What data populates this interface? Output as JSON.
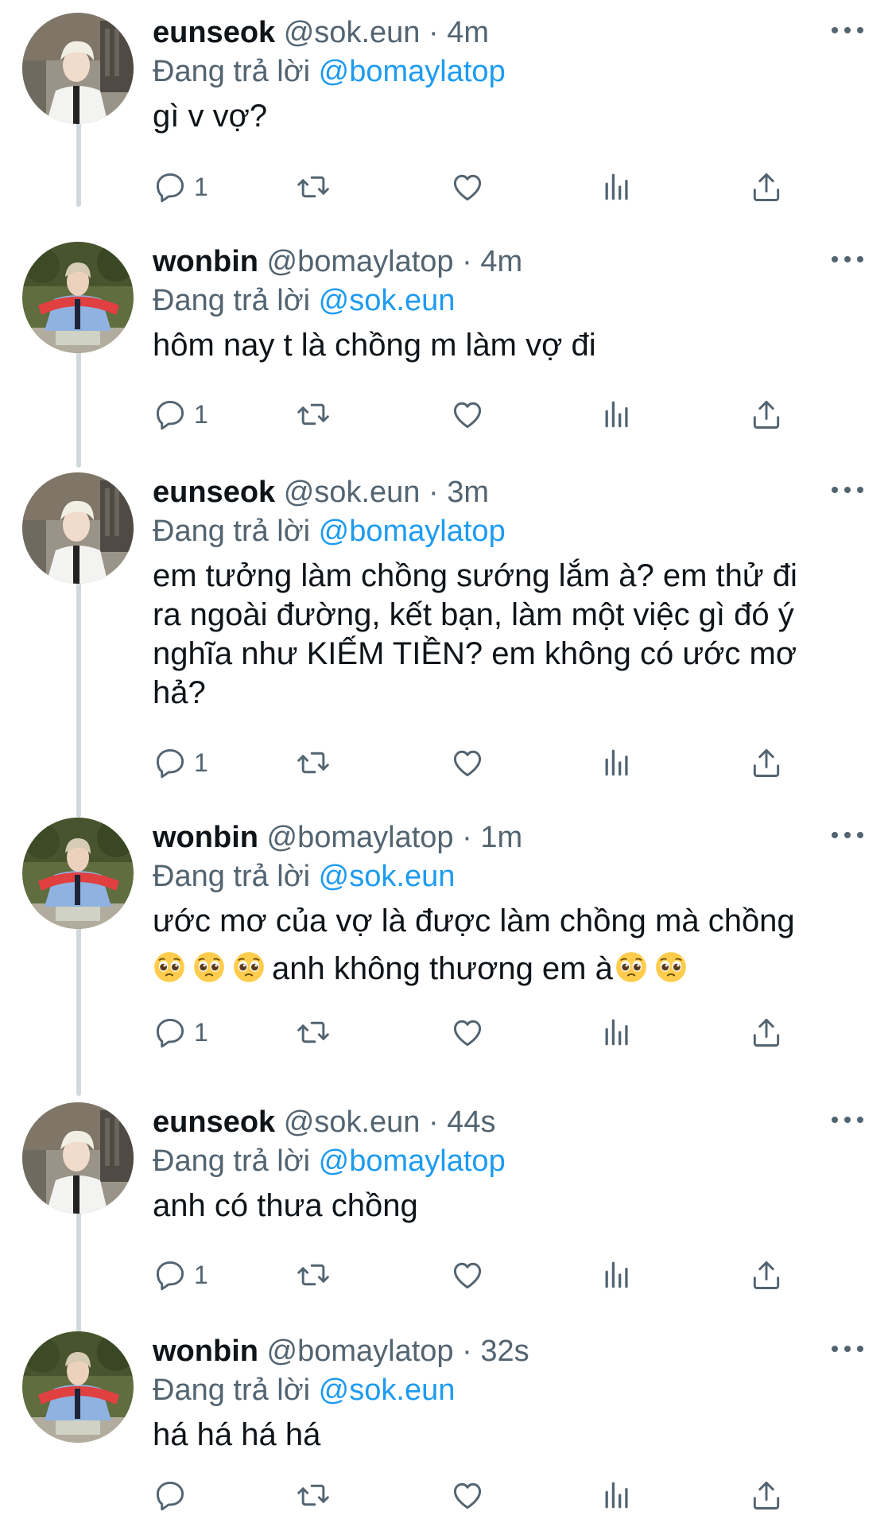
{
  "reply_prefix": "Đang trả lời",
  "tweets": [
    {
      "name": "eunseok",
      "handle": "@sok.eun",
      "separator": "·",
      "time": "4m",
      "replying_to": "@bomaylatop",
      "text": "gì v vợ?",
      "reply_count": "1"
    },
    {
      "name": "wonbin",
      "handle": "@bomaylatop",
      "separator": "·",
      "time": "4m",
      "replying_to": "@sok.eun",
      "text": "hôm nay t là chồng m làm vợ đi",
      "reply_count": "1"
    },
    {
      "name": "eunseok",
      "handle": "@sok.eun",
      "separator": "·",
      "time": "3m",
      "replying_to": "@bomaylatop",
      "text_lines": [
        "em tưởng làm chồng sướng lắm à? em thử đi",
        "ra ngoài đường, kết bạn, làm một việc gì đó ý",
        "nghĩa như KIẾM TIỀN? em không có ước mơ",
        "hả?"
      ],
      "reply_count": "1"
    },
    {
      "name": "wonbin",
      "handle": "@bomaylatop",
      "separator": "·",
      "time": "1m",
      "replying_to": "@sok.eun",
      "text_line1": "ước mơ của vợ là được làm chồng mà chồng",
      "text_line2": "anh không thương em à",
      "emoji_name": "pleading-face-emoji",
      "reply_count": "1"
    },
    {
      "name": "eunseok",
      "handle": "@sok.eun",
      "separator": "·",
      "time": "44s",
      "replying_to": "@bomaylatop",
      "text": "anh có thưa chồng",
      "reply_count": "1"
    },
    {
      "name": "wonbin",
      "handle": "@bomaylatop",
      "separator": "·",
      "time": "32s",
      "replying_to": "@sok.eun",
      "text": "há há há há",
      "reply_count": ""
    }
  ],
  "icons": {
    "reply": "reply-icon",
    "retweet": "retweet-icon",
    "like": "heart-icon",
    "stats": "views-icon",
    "share": "share-icon",
    "more": "more-options-icon"
  },
  "colors": {
    "text": "#0f1419",
    "muted": "#536471",
    "link": "#1d9bf0",
    "thread_line": "#cfd9de"
  }
}
